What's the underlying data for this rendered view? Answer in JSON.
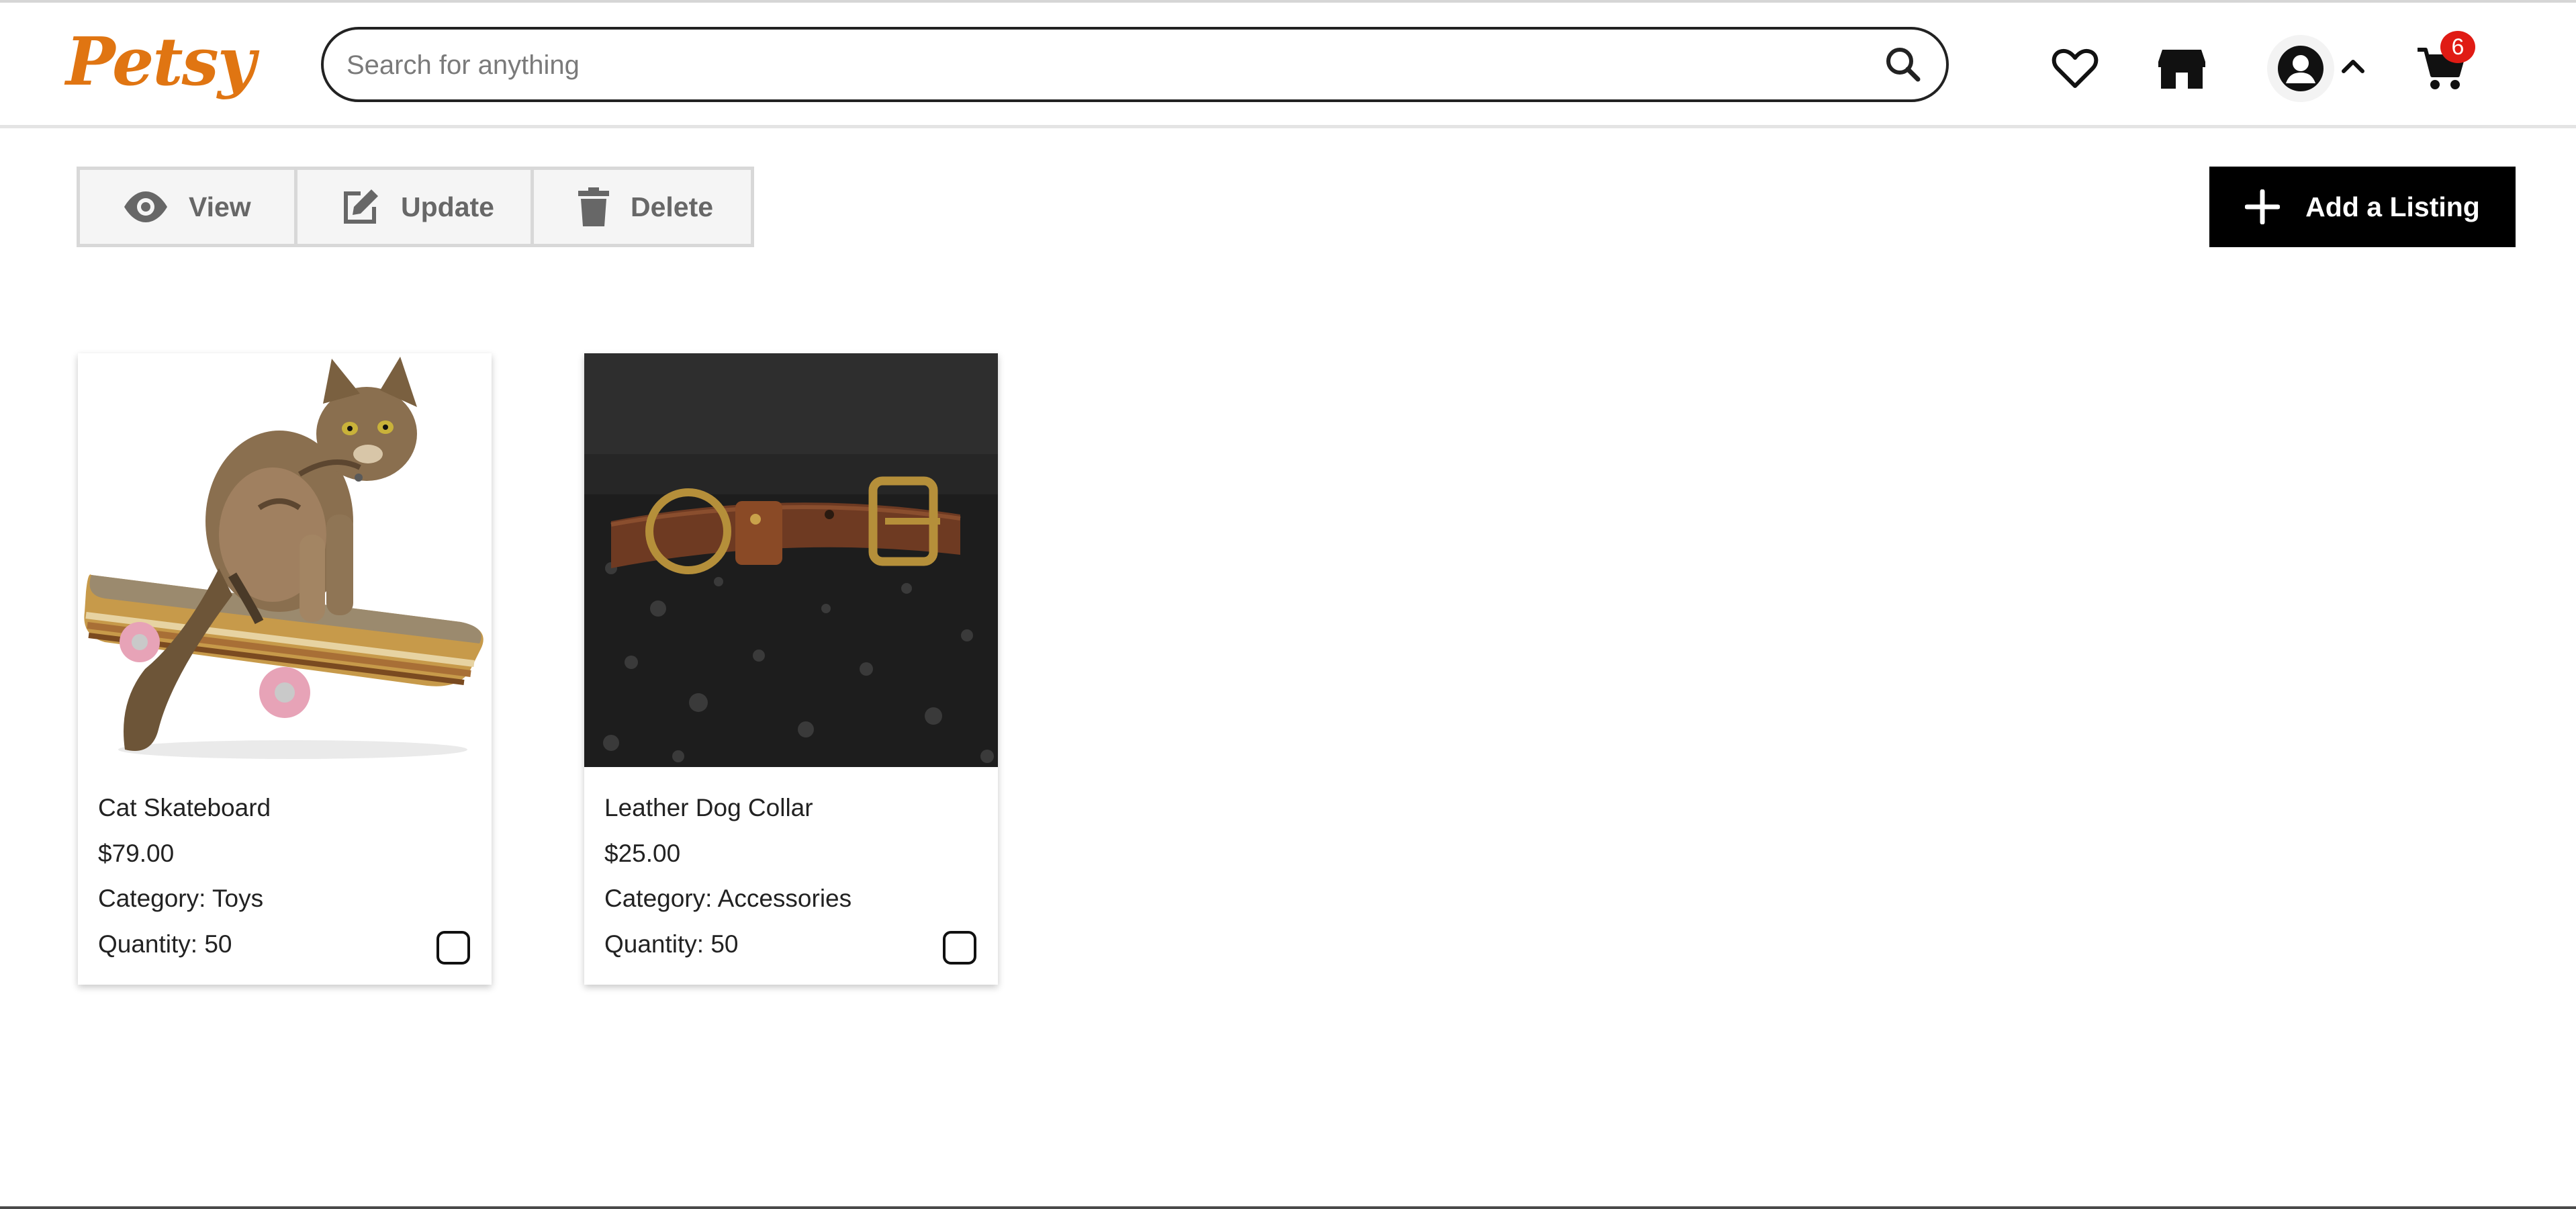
{
  "header": {
    "logo_text": "Petsy",
    "search_placeholder": "Search for anything",
    "cart_count": "6"
  },
  "toolbar": {
    "view_label": "View",
    "update_label": "Update",
    "delete_label": "Delete",
    "add_listing_label": "Add a Listing"
  },
  "listings": [
    {
      "title": "Cat Skateboard",
      "price": "$79.00",
      "category_label": "Category:",
      "category": "Toys",
      "quantity_label": "Quantity:",
      "quantity": "50"
    },
    {
      "title": "Leather Dog Collar",
      "price": "$25.00",
      "category_label": "Category:",
      "category": "Accessories",
      "quantity_label": "Quantity:",
      "quantity": "50"
    }
  ],
  "colors": {
    "brand": "#e07512",
    "primary_button": "#000000",
    "badge": "#e01b14"
  },
  "icons": [
    "search-icon",
    "heart-icon",
    "shop-icon",
    "account-icon",
    "chevron-up-icon",
    "cart-icon",
    "eye-icon",
    "edit-icon",
    "trash-icon",
    "plus-icon"
  ]
}
